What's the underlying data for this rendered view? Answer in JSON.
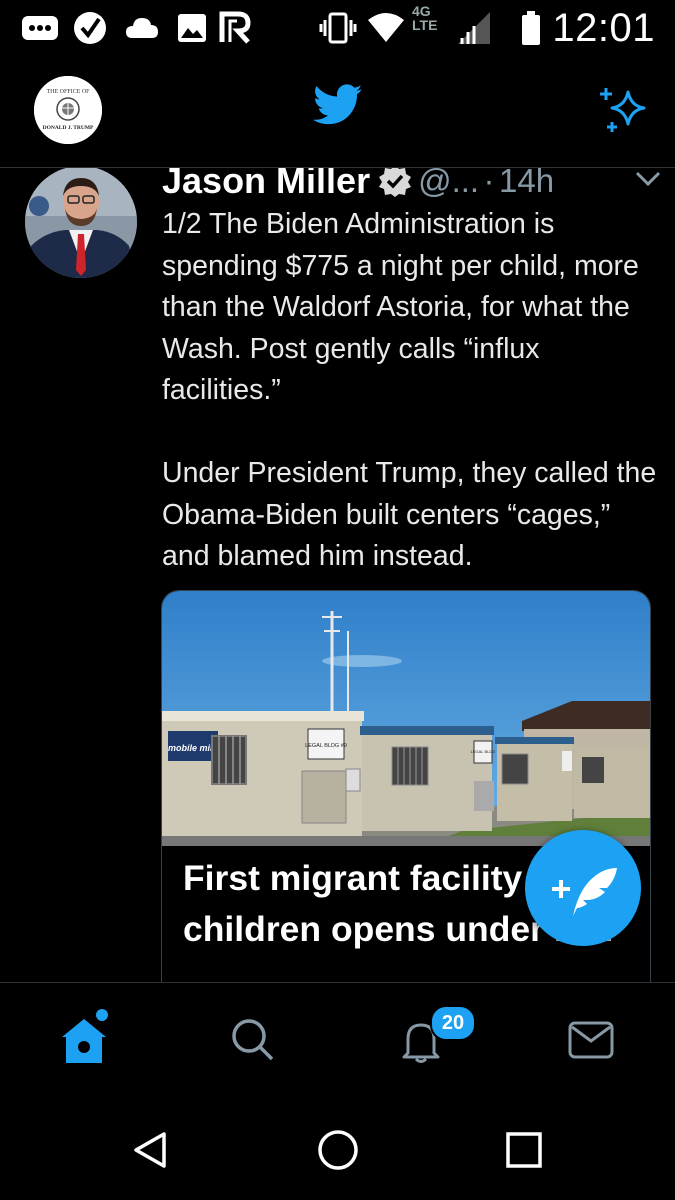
{
  "status_bar": {
    "time": "12:01",
    "network": "4G LTE",
    "icons": [
      "more-icon",
      "check-icon",
      "cloud-icon",
      "image-icon",
      "r-app-icon",
      "vibrate-icon",
      "wifi-icon",
      "signal-icon",
      "battery-icon"
    ]
  },
  "header": {
    "account_avatar_text": [
      "THE OFFICE OF",
      "DONALD J. TRUMP"
    ],
    "logo": "twitter-bird-icon",
    "action": "sparkle-icon"
  },
  "tweet": {
    "author_name": "Jason Miller",
    "handle": "@...",
    "separator": "·",
    "time": "14h",
    "text_paragraphs": [
      "1/2 The Biden Administration is spending $775 a night per child, more than the Waldorf Astoria, for what the Wash. Post gently calls “influx facilities.”",
      "Under President Trump, they called the Obama-Biden built centers “cages,” and blamed him instead."
    ],
    "card": {
      "title": "First migrant facility for children opens under B…",
      "image_sign_1": "mobile mini",
      "image_sign_2": "LEGAL BLDG #9",
      "image_sign_3": "LEGAL BLDG"
    }
  },
  "fab": {
    "icon": "compose-tweet-icon"
  },
  "bottom_nav": {
    "items": [
      "home",
      "search",
      "notifications",
      "messages"
    ],
    "notification_count": "20",
    "active_color": "#1da1f2",
    "inactive_color": "#8899a6"
  },
  "colors": {
    "accent": "#1da1f2",
    "background": "#000000",
    "secondary_text": "#8899a6"
  }
}
